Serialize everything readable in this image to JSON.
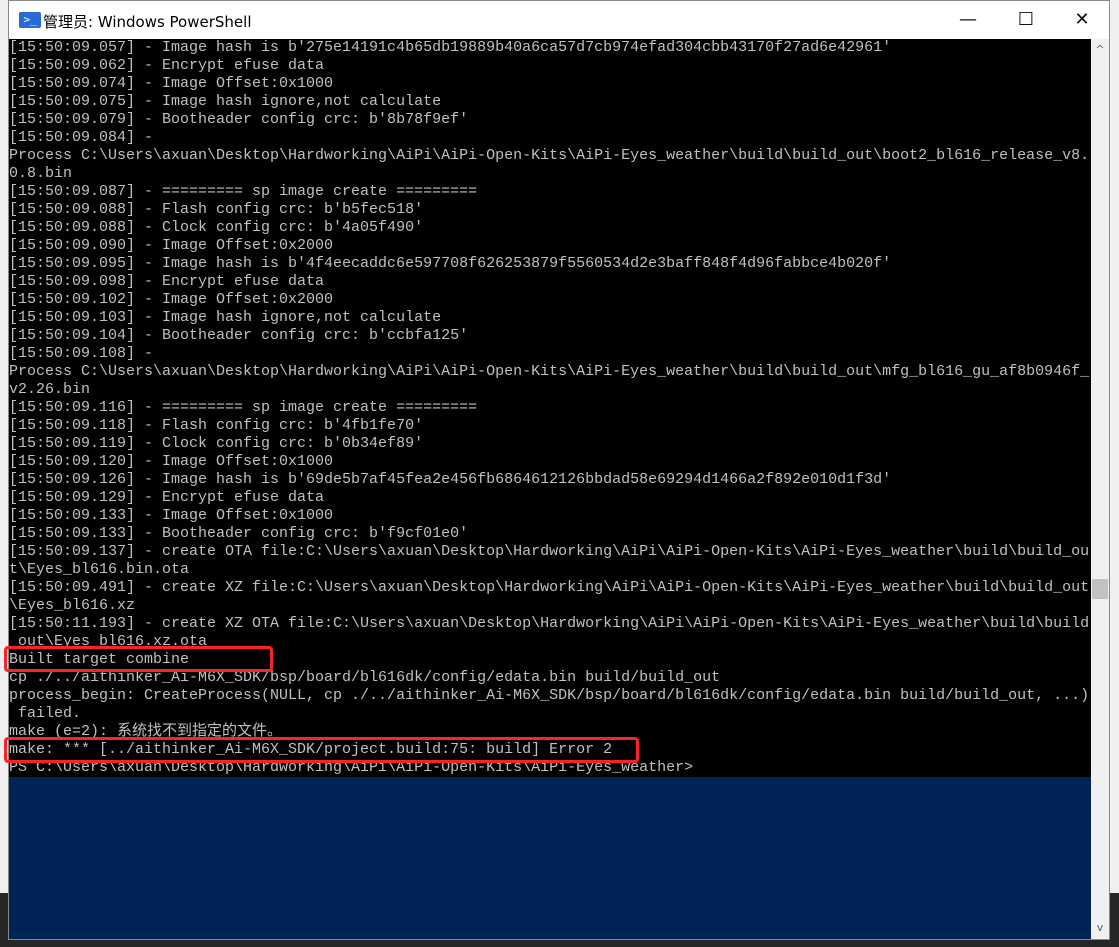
{
  "window": {
    "title": "管理员: Windows PowerShell",
    "icon": "powershell-icon",
    "controls": {
      "minimize": "—",
      "maximize": "☐",
      "close": "✕"
    }
  },
  "colors": {
    "console_bg": "#000000",
    "powershell_blue": "#012456",
    "highlight": "#ff2222"
  },
  "console": {
    "lines": [
      "[15:50:09.057] - Image hash is b'275e14191c4b65db19889b40a6ca57d7cb974efad304cbb43170f27ad6e42961'",
      "[15:50:09.062] - Encrypt efuse data",
      "[15:50:09.074] - Image Offset:0x1000",
      "[15:50:09.075] - Image hash ignore,not calculate",
      "[15:50:09.079] - Bootheader config crc: b'8b78f9ef'",
      "[15:50:09.084] -",
      "Process C:\\Users\\axuan\\Desktop\\Hardworking\\AiPi\\AiPi-Open-Kits\\AiPi-Eyes_weather\\build\\build_out\\boot2_bl616_release_v8.",
      "0.8.bin",
      "[15:50:09.087] - ========= sp image create =========",
      "[15:50:09.088] - Flash config crc: b'b5fec518'",
      "[15:50:09.088] - Clock config crc: b'4a05f490'",
      "[15:50:09.090] - Image Offset:0x2000",
      "[15:50:09.095] - Image hash is b'4f4eecaddc6e597708f626253879f5560534d2e3baff848f4d96fabbce4b020f'",
      "[15:50:09.098] - Encrypt efuse data",
      "[15:50:09.102] - Image Offset:0x2000",
      "[15:50:09.103] - Image hash ignore,not calculate",
      "[15:50:09.104] - Bootheader config crc: b'ccbfa125'",
      "[15:50:09.108] -",
      "Process C:\\Users\\axuan\\Desktop\\Hardworking\\AiPi\\AiPi-Open-Kits\\AiPi-Eyes_weather\\build\\build_out\\mfg_bl616_gu_af8b0946f_",
      "v2.26.bin",
      "[15:50:09.116] - ========= sp image create =========",
      "[15:50:09.118] - Flash config crc: b'4fb1fe70'",
      "[15:50:09.119] - Clock config crc: b'0b34ef89'",
      "[15:50:09.120] - Image Offset:0x1000",
      "[15:50:09.126] - Image hash is b'69de5b7af45fea2e456fb6864612126bbdad58e69294d1466a2f892e010d1f3d'",
      "[15:50:09.129] - Encrypt efuse data",
      "[15:50:09.133] - Image Offset:0x1000",
      "[15:50:09.133] - Bootheader config crc: b'f9cf01e0'",
      "[15:50:09.137] - create OTA file:C:\\Users\\axuan\\Desktop\\Hardworking\\AiPi\\AiPi-Open-Kits\\AiPi-Eyes_weather\\build\\build_ou",
      "t\\Eyes_bl616.bin.ota",
      "[15:50:09.491] - create XZ file:C:\\Users\\axuan\\Desktop\\Hardworking\\AiPi\\AiPi-Open-Kits\\AiPi-Eyes_weather\\build\\build_out",
      "\\Eyes_bl616.xz",
      "[15:50:11.193] - create XZ OTA file:C:\\Users\\axuan\\Desktop\\Hardworking\\AiPi\\AiPi-Open-Kits\\AiPi-Eyes_weather\\build\\build",
      "_out\\Eyes_bl616.xz.ota",
      "Built target combine",
      "cp ./../aithinker_Ai-M6X_SDK/bsp/board/bl616dk/config/edata.bin build/build_out",
      "process_begin: CreateProcess(NULL, cp ./../aithinker_Ai-M6X_SDK/bsp/board/bl616dk/config/edata.bin build/build_out, ...)",
      " failed.",
      "make (e=2): 系统找不到指定的文件。",
      "make: *** [../aithinker_Ai-M6X_SDK/project.build:75: build] Error 2",
      "PS C:\\Users\\axuan\\Desktop\\Hardworking\\AiPi\\AiPi-Open-Kits\\AiPi-Eyes_weather>"
    ]
  },
  "scrollbar": {
    "up": "^",
    "down": "v"
  }
}
